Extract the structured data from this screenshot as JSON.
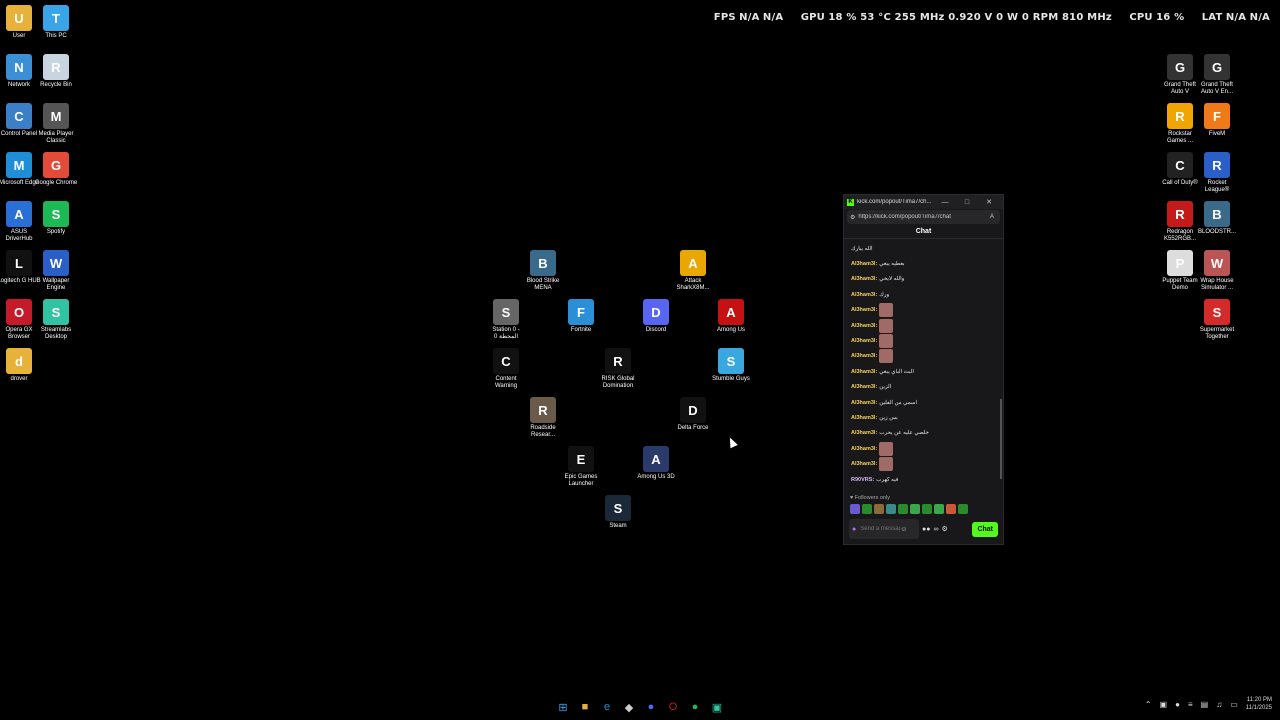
{
  "overlay": {
    "fps_label": "FPS",
    "fps_value": "N/A",
    "fps_value2": "N/A",
    "gpu_label": "GPU",
    "gpu_values": "18 % 53 °C 255 MHz 0.920 V 0 W 0 RPM 810 MHz",
    "cpu_label": "CPU",
    "cpu_value": "16 %",
    "lat_label": "LAT",
    "lat_value": "N/A",
    "lat_value2": "N/A"
  },
  "desktop_left": [
    {
      "label": "User",
      "icon": "folder-icon",
      "color": "#e8b13a"
    },
    {
      "label": "This PC",
      "icon": "monitor-icon",
      "color": "#3aa4e8"
    },
    {
      "label": "Network",
      "icon": "network-icon",
      "color": "#3a8fd6"
    },
    {
      "label": "Recycle Bin",
      "icon": "recycle-bin-icon",
      "color": "#c8d4e0"
    },
    {
      "label": "Control Panel",
      "icon": "control-panel-icon",
      "color": "#3a7fc8"
    },
    {
      "label": "Media Player Classic",
      "icon": "media-player-icon",
      "color": "#555"
    },
    {
      "label": "Microsoft Edge",
      "icon": "edge-icon",
      "color": "#1e8fd6"
    },
    {
      "label": "Google Chrome",
      "icon": "chrome-icon",
      "color": "#e24a3a"
    },
    {
      "label": "ASUS DriverHub",
      "icon": "asus-icon",
      "color": "#2a6fd6"
    },
    {
      "label": "Spotify",
      "icon": "spotify-icon",
      "color": "#1db954"
    },
    {
      "label": "Logitech G HUB",
      "icon": "logitech-icon",
      "color": "#111"
    },
    {
      "label": "Wallpaper Engine",
      "icon": "wallpaper-engine-icon",
      "color": "#2a5fc8"
    },
    {
      "label": "Opera GX Browser",
      "icon": "opera-gx-icon",
      "color": "#c41a2a"
    },
    {
      "label": "Streamlabs Desktop",
      "icon": "streamlabs-icon",
      "color": "#31c3a2"
    },
    {
      "label": "drover",
      "icon": "folder-icon",
      "color": "#e8b13a"
    }
  ],
  "desktop_right": [
    {
      "label": "Grand Theft Auto V",
      "icon": "gta-icon",
      "color": "#333"
    },
    {
      "label": "Grand Theft Auto V En...",
      "icon": "gta-enhanced-icon",
      "color": "#333"
    },
    {
      "label": "Rockstar Games ...",
      "icon": "rockstar-icon",
      "color": "#f0a500"
    },
    {
      "label": "FiveM",
      "icon": "fivem-icon",
      "color": "#f07a1a"
    },
    {
      "label": "Call of Duty®",
      "icon": "cod-icon",
      "color": "#222"
    },
    {
      "label": "Rocket League®",
      "icon": "rocket-league-icon",
      "color": "#2a5fc8"
    },
    {
      "label": "Redragon K552RGB...",
      "icon": "redragon-icon",
      "color": "#c41a1a"
    },
    {
      "label": "BLOODSTR...",
      "icon": "bloodstrike-icon",
      "color": "#3a6a8a"
    },
    {
      "label": "Puppet Team Demo",
      "icon": "puppet-team-icon",
      "color": "#ddd"
    },
    {
      "label": "Wrap House Simulator ...",
      "icon": "wrap-house-icon",
      "color": "#b55"
    },
    {
      "label": "Supermarket Together",
      "icon": "supermarket-icon",
      "color": "#d42a2a"
    }
  ],
  "desktop_center": [
    {
      "label": "Blood Strike MENA",
      "icon": "bloodstrike-icon",
      "color": "#3a6a8a"
    },
    {
      "label": "Attack SharkX8M...",
      "icon": "attack-shark-icon",
      "color": "#e8a800"
    },
    {
      "label": "Station 0 - المحطة 0",
      "icon": "station-icon",
      "color": "#666"
    },
    {
      "label": "Fortnite",
      "icon": "fortnite-icon",
      "color": "#2a8fd6"
    },
    {
      "label": "Discord",
      "icon": "discord-icon",
      "color": "#5865f2"
    },
    {
      "label": "Among Us",
      "icon": "among-us-icon",
      "color": "#c51111"
    },
    {
      "label": "Content Warning",
      "icon": "content-warning-icon",
      "color": "#111"
    },
    {
      "label": "RISK Global Domination",
      "icon": "risk-icon",
      "color": "#111"
    },
    {
      "label": "Stumble Guys",
      "icon": "stumble-guys-icon",
      "color": "#3aa8e0"
    },
    {
      "label": "Roadside Resear...",
      "icon": "roadside-icon",
      "color": "#6a5a4a"
    },
    {
      "label": "Delta Force",
      "icon": "delta-force-icon",
      "color": "#111"
    },
    {
      "label": "Epic Games Launcher",
      "icon": "epic-icon",
      "color": "#111"
    },
    {
      "label": "Among Us 3D",
      "icon": "among-us-3d-icon",
      "color": "#2a3a6a"
    },
    {
      "label": "Steam",
      "icon": "steam-icon",
      "color": "#1b2838"
    }
  ],
  "browser": {
    "title": "kick.com/popout/Tima7/ch...",
    "url": "https://kick.com/popout/Tima7/chat",
    "chat_header": "Chat",
    "followers_only": "Followers only",
    "input_placeholder": "Send a message",
    "send_label": "Chat",
    "messages": [
      {
        "user": "",
        "text": "الله يبارك"
      },
      {
        "user": "Al3ham3l:",
        "text": "بعطيه يبغي"
      },
      {
        "user": "Al3ham3l:",
        "text": "والله لايخي"
      },
      {
        "user": "Al3ham3l:",
        "text": "ورك"
      },
      {
        "user": "Al3ham3l:",
        "text": "",
        "emote": true
      },
      {
        "user": "Al3ham3l:",
        "text": "",
        "emote": true
      },
      {
        "user": "Al3ham3l:",
        "text": "",
        "emote": true
      },
      {
        "user": "Al3ham3l:",
        "text": "",
        "emote": true
      },
      {
        "user": "Al3ham3l:",
        "text": "البث الباي يبغي"
      },
      {
        "user": "Al3ham3l:",
        "text": "الزين"
      },
      {
        "user": "Al3ham3l:",
        "text": "اسمي من الفلين"
      },
      {
        "user": "Al3ham3l:",
        "text": "بس زين"
      },
      {
        "user": "Al3ham3l:",
        "text": "خلصي عليه عن يحرب"
      },
      {
        "user": "Al3ham3l:",
        "text": "",
        "emote": true
      },
      {
        "user": "Al3ham3l:",
        "text": "",
        "emote": true
      },
      {
        "user": "R90VRS:",
        "text": "فيه كهرب"
      }
    ]
  },
  "taskbar": {
    "apps": [
      "windows-start-icon",
      "file-explorer-icon",
      "edge-icon",
      "roblox-icon",
      "discord-icon",
      "opera-gx-icon",
      "spotify-icon",
      "streamlabs-icon"
    ],
    "time": "11:20 PM",
    "date": "11/1/2025"
  }
}
